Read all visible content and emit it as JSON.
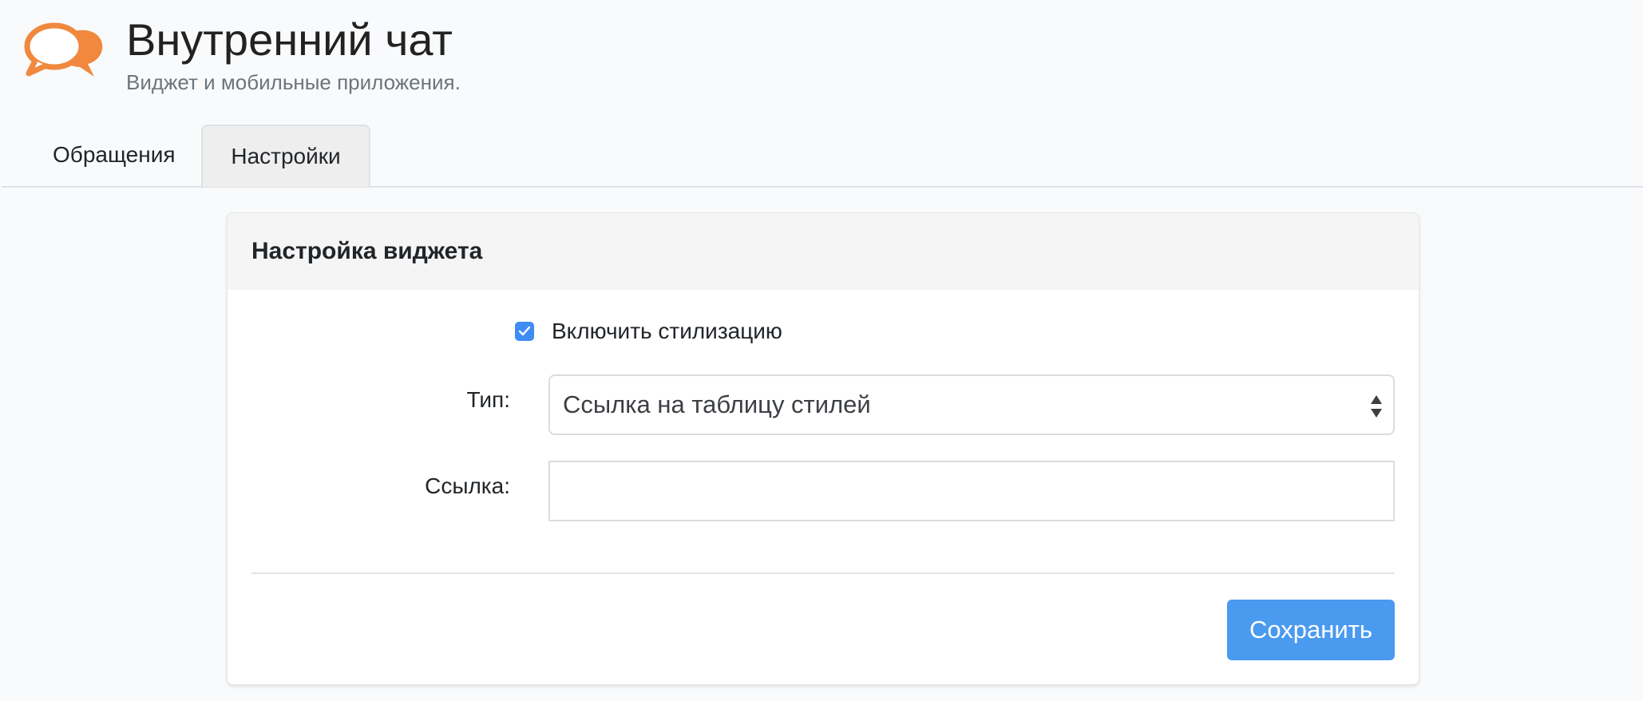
{
  "app": {
    "title": "Внутренний чат",
    "subtitle": "Виджет и мобильные приложения.",
    "logo_icon": "chat-bubbles-icon",
    "accent_color": "#f0883e"
  },
  "tabs": [
    {
      "label": "Обращения",
      "active": false
    },
    {
      "label": "Настройки",
      "active": true
    }
  ],
  "widget_settings": {
    "header": "Настройка виджета",
    "enable_styling": {
      "label": "Включить стилизацию",
      "checked": true
    },
    "type_field": {
      "label": "Тип:",
      "selected": "Ссылка на таблицу стилей"
    },
    "link_field": {
      "label": "Ссылка:",
      "value": ""
    },
    "save_label": "Сохранить",
    "primary_color": "#4a9aef"
  }
}
